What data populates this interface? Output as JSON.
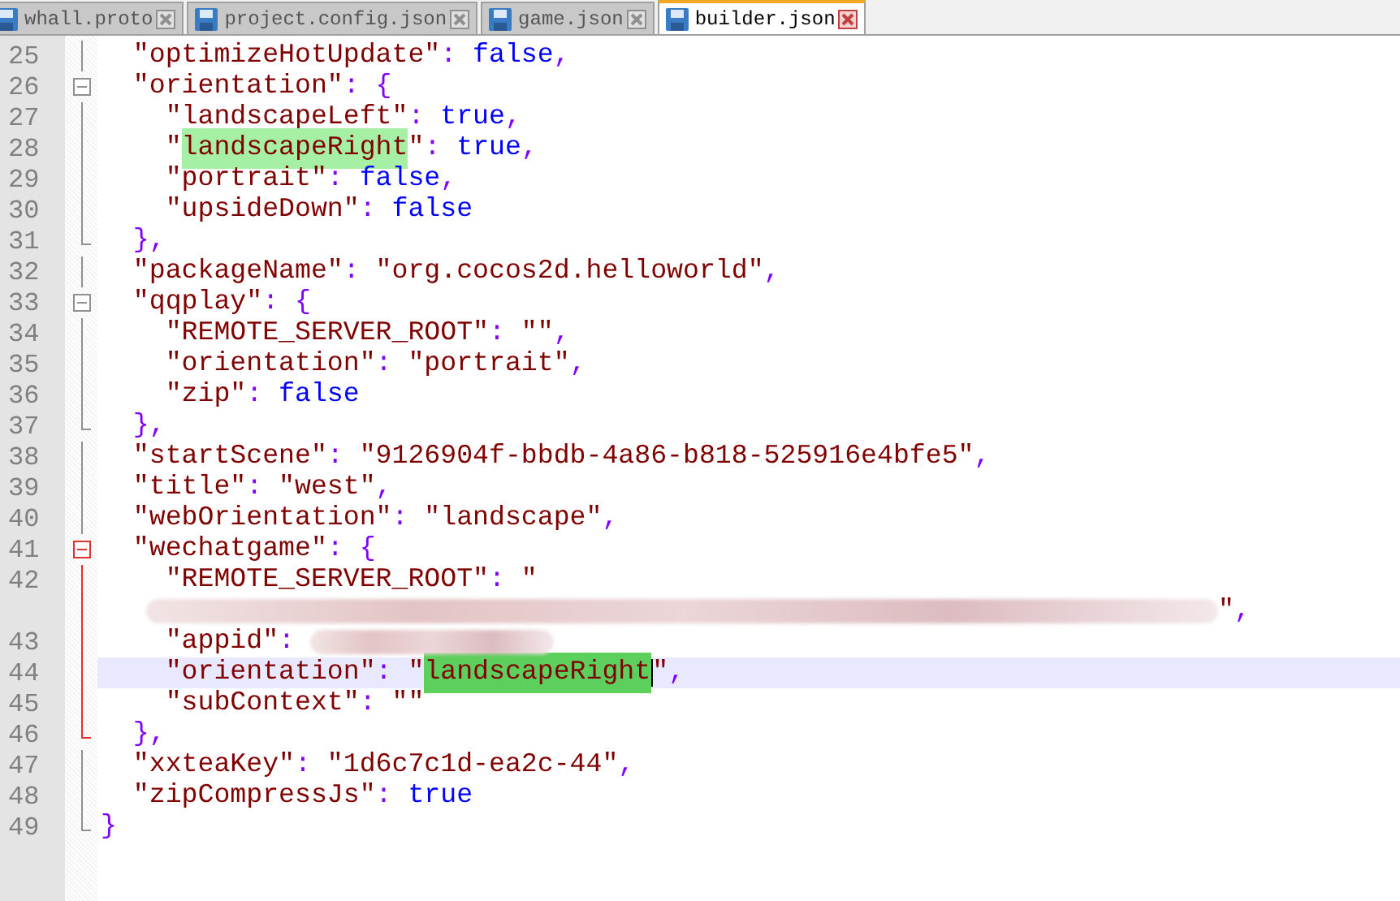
{
  "tabs": [
    {
      "label": "whall.proto",
      "selected": false
    },
    {
      "label": "project.config.json",
      "selected": false
    },
    {
      "label": "game.json",
      "selected": false
    },
    {
      "label": "builder.json",
      "selected": true
    }
  ],
  "editor": {
    "lines": [
      {
        "number": "25",
        "kind": "body",
        "active_block": false,
        "current": false,
        "tokens": [
          {
            "kind": "key",
            "text": "  \"optimizeHotUpdate\""
          },
          {
            "kind": "punct",
            "text": ": "
          },
          {
            "kind": "bool",
            "text": "false"
          },
          {
            "kind": "punct",
            "text": ","
          }
        ]
      },
      {
        "number": "26",
        "kind": "fold-start",
        "active_block": false,
        "current": false,
        "tokens": [
          {
            "kind": "key",
            "text": "  \"orientation\""
          },
          {
            "kind": "punct",
            "text": ": "
          },
          {
            "kind": "brace",
            "text": "{"
          }
        ]
      },
      {
        "number": "27",
        "kind": "body",
        "active_block": false,
        "current": false,
        "tokens": [
          {
            "kind": "key",
            "text": "    \"landscapeLeft\""
          },
          {
            "kind": "punct",
            "text": ": "
          },
          {
            "kind": "bool",
            "text": "true"
          },
          {
            "kind": "punct",
            "text": ","
          }
        ]
      },
      {
        "number": "28",
        "kind": "body",
        "active_block": false,
        "current": false,
        "tokens": [
          {
            "kind": "key",
            "text": "    \""
          },
          {
            "kind": "key",
            "text": "landscapeRight",
            "found": true
          },
          {
            "kind": "key",
            "text": "\""
          },
          {
            "kind": "punct",
            "text": ": "
          },
          {
            "kind": "bool",
            "text": "true"
          },
          {
            "kind": "punct",
            "text": ","
          }
        ]
      },
      {
        "number": "29",
        "kind": "body",
        "active_block": false,
        "current": false,
        "tokens": [
          {
            "kind": "key",
            "text": "    \"portrait\""
          },
          {
            "kind": "punct",
            "text": ": "
          },
          {
            "kind": "bool",
            "text": "false"
          },
          {
            "kind": "punct",
            "text": ","
          }
        ]
      },
      {
        "number": "30",
        "kind": "body",
        "active_block": false,
        "current": false,
        "tokens": [
          {
            "kind": "key",
            "text": "    \"upsideDown\""
          },
          {
            "kind": "punct",
            "text": ": "
          },
          {
            "kind": "bool",
            "text": "false"
          }
        ]
      },
      {
        "number": "31",
        "kind": "fold-end",
        "active_block": false,
        "current": false,
        "tokens": [
          {
            "kind": "brace",
            "text": "  },"
          }
        ]
      },
      {
        "number": "32",
        "kind": "body",
        "active_block": false,
        "current": false,
        "tokens": [
          {
            "kind": "key",
            "text": "  \"packageName\""
          },
          {
            "kind": "punct",
            "text": ": "
          },
          {
            "kind": "string",
            "text": "\"org.cocos2d.helloworld\""
          },
          {
            "kind": "punct",
            "text": ","
          }
        ]
      },
      {
        "number": "33",
        "kind": "fold-start",
        "active_block": false,
        "current": false,
        "tokens": [
          {
            "kind": "key",
            "text": "  \"qqplay\""
          },
          {
            "kind": "punct",
            "text": ": "
          },
          {
            "kind": "brace",
            "text": "{"
          }
        ]
      },
      {
        "number": "34",
        "kind": "body",
        "active_block": false,
        "current": false,
        "tokens": [
          {
            "kind": "key",
            "text": "    \"REMOTE_SERVER_ROOT\""
          },
          {
            "kind": "punct",
            "text": ": "
          },
          {
            "kind": "string",
            "text": "\"\""
          },
          {
            "kind": "punct",
            "text": ","
          }
        ]
      },
      {
        "number": "35",
        "kind": "body",
        "active_block": false,
        "current": false,
        "tokens": [
          {
            "kind": "key",
            "text": "    \"orientation\""
          },
          {
            "kind": "punct",
            "text": ": "
          },
          {
            "kind": "string",
            "text": "\"portrait\""
          },
          {
            "kind": "punct",
            "text": ","
          }
        ]
      },
      {
        "number": "36",
        "kind": "body",
        "active_block": false,
        "current": false,
        "tokens": [
          {
            "kind": "key",
            "text": "    \"zip\""
          },
          {
            "kind": "punct",
            "text": ": "
          },
          {
            "kind": "bool",
            "text": "false"
          }
        ]
      },
      {
        "number": "37",
        "kind": "fold-end",
        "active_block": false,
        "current": false,
        "tokens": [
          {
            "kind": "brace",
            "text": "  },"
          }
        ]
      },
      {
        "number": "38",
        "kind": "body",
        "active_block": false,
        "current": false,
        "tokens": [
          {
            "kind": "key",
            "text": "  \"startScene\""
          },
          {
            "kind": "punct",
            "text": ": "
          },
          {
            "kind": "string",
            "text": "\"9126904f-bbdb-4a86-b818-525916e4bfe5\""
          },
          {
            "kind": "punct",
            "text": ","
          }
        ]
      },
      {
        "number": "39",
        "kind": "body",
        "active_block": false,
        "current": false,
        "tokens": [
          {
            "kind": "key",
            "text": "  \"title\""
          },
          {
            "kind": "punct",
            "text": ": "
          },
          {
            "kind": "string",
            "text": "\"west\""
          },
          {
            "kind": "punct",
            "text": ","
          }
        ]
      },
      {
        "number": "40",
        "kind": "body",
        "active_block": false,
        "current": false,
        "tokens": [
          {
            "kind": "key",
            "text": "  \"webOrientation\""
          },
          {
            "kind": "punct",
            "text": ": "
          },
          {
            "kind": "string",
            "text": "\"landscape\""
          },
          {
            "kind": "punct",
            "text": ","
          }
        ]
      },
      {
        "number": "41",
        "kind": "fold-start",
        "active_block": true,
        "current": false,
        "tokens": [
          {
            "kind": "key",
            "text": "  \"wechatgame\""
          },
          {
            "kind": "punct",
            "text": ": "
          },
          {
            "kind": "brace",
            "text": "{"
          }
        ]
      },
      {
        "number": "42",
        "kind": "body",
        "active_block": true,
        "current": false,
        "tokens": [
          {
            "kind": "key",
            "text": "    \"REMOTE_SERVER_ROOT\""
          },
          {
            "kind": "punct",
            "text": ": "
          },
          {
            "kind": "string",
            "text": "\""
          }
        ],
        "wrap": [
          {
            "kind": "redacted-wide"
          },
          {
            "kind": "string",
            "text": "\""
          },
          {
            "kind": "punct",
            "text": ","
          }
        ]
      },
      {
        "number": "43",
        "kind": "body",
        "active_block": true,
        "current": false,
        "tokens": [
          {
            "kind": "key",
            "text": "    \"appid\""
          },
          {
            "kind": "punct",
            "text": ": "
          },
          {
            "kind": "redacted-narrow"
          }
        ]
      },
      {
        "number": "44",
        "kind": "body",
        "active_block": true,
        "current": true,
        "tokens": [
          {
            "kind": "key",
            "text": "    \"orientation\""
          },
          {
            "kind": "punct",
            "text": ": "
          },
          {
            "kind": "string",
            "text": "\""
          },
          {
            "kind": "string",
            "text": "landscapeRight",
            "selected": true
          },
          {
            "kind": "string",
            "text": "\""
          },
          {
            "kind": "punct",
            "text": ","
          }
        ]
      },
      {
        "number": "45",
        "kind": "body",
        "active_block": true,
        "current": false,
        "tokens": [
          {
            "kind": "key",
            "text": "    \"subContext\""
          },
          {
            "kind": "punct",
            "text": ": "
          },
          {
            "kind": "string",
            "text": "\"\""
          }
        ]
      },
      {
        "number": "46",
        "kind": "fold-end",
        "active_block": true,
        "current": false,
        "tokens": [
          {
            "kind": "brace",
            "text": "  },"
          }
        ]
      },
      {
        "number": "47",
        "kind": "body",
        "active_block": false,
        "current": false,
        "tokens": [
          {
            "kind": "key",
            "text": "  \"xxteaKey\""
          },
          {
            "kind": "punct",
            "text": ": "
          },
          {
            "kind": "string",
            "text": "\"1d6c7c1d-ea2c-44\""
          },
          {
            "kind": "punct",
            "text": ","
          }
        ]
      },
      {
        "number": "48",
        "kind": "body",
        "active_block": false,
        "current": false,
        "tokens": [
          {
            "kind": "key",
            "text": "  \"zipCompressJs\""
          },
          {
            "kind": "punct",
            "text": ": "
          },
          {
            "kind": "bool",
            "text": "true"
          }
        ]
      },
      {
        "number": "49",
        "kind": "fold-end",
        "active_block": false,
        "current": false,
        "tokens": [
          {
            "kind": "brace",
            "text": "}"
          }
        ]
      }
    ]
  }
}
